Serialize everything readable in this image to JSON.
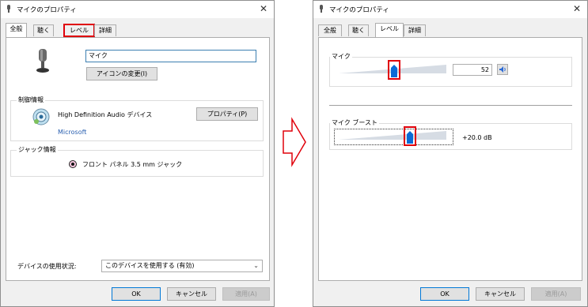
{
  "left_window": {
    "title": "マイクのプロパティ",
    "tabs": [
      {
        "label": "全般"
      },
      {
        "label": "聴く"
      },
      {
        "label": "レベル"
      },
      {
        "label": "詳細"
      }
    ],
    "device_name_value": "マイク",
    "change_icon_button": "アイコンの変更(I)",
    "controller_group_label": "制御情報",
    "controller_name": "High Definition Audio デバイス",
    "controller_vendor": "Microsoft",
    "properties_button": "プロパティ(P)",
    "jack_group_label": "ジャック情報",
    "jack_text": "フロント パネル 3.5 mm ジャック",
    "device_usage_label": "デバイスの使用状況:",
    "device_usage_value": "このデバイスを使用する (有効)",
    "buttons": {
      "ok": "OK",
      "cancel": "キャンセル",
      "apply": "適用(A)"
    }
  },
  "arrow_color": "#e0000a",
  "right_window": {
    "title": "マイクのプロパティ",
    "tabs": [
      {
        "label": "全般"
      },
      {
        "label": "聴く"
      },
      {
        "label": "レベル"
      },
      {
        "label": "詳細"
      }
    ],
    "mic_group_label": "マイク",
    "mic_level_value": "52",
    "mic_level_fraction": 0.52,
    "boost_group_label": "マイク ブースト",
    "boost_value": "+20.0 dB",
    "boost_fraction": 0.67,
    "buttons": {
      "ok": "OK",
      "cancel": "キャンセル",
      "apply": "適用(A)"
    }
  },
  "icons": {
    "title_icon": "microphone-icon",
    "device_icon": "microphone-icon",
    "controller_icon": "speaker-cd-icon",
    "jack_icon": "jack-dot-icon",
    "mute_icon": "speaker-icon",
    "close_icon": "close-icon",
    "dropdown_icon": "chevron-down-icon"
  }
}
